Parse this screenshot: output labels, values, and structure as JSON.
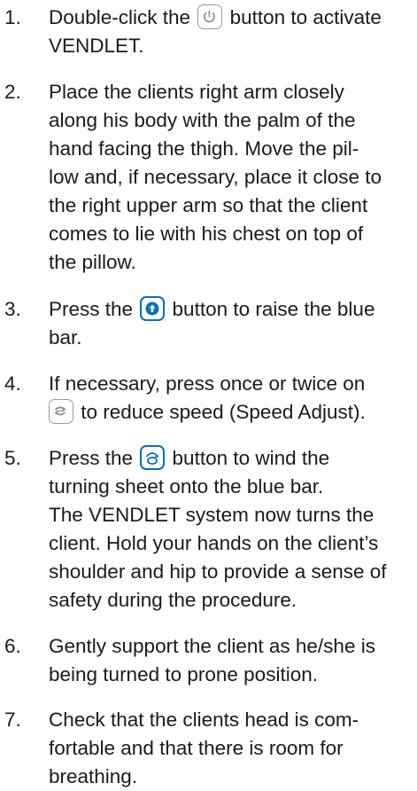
{
  "steps": [
    {
      "number": "1.",
      "lines": [
        [
          "Double-click the ",
          {
            "icon": "power-icon"
          },
          " button to activate"
        ],
        [
          "VENDLET."
        ]
      ]
    },
    {
      "number": "2.",
      "lines": [
        [
          "Place the clients right arm closely"
        ],
        [
          "along his body with the palm of the"
        ],
        [
          "hand facing the thigh. Move the pil-"
        ],
        [
          "low and, if necessary, place it close to"
        ],
        [
          "the right upper arm so that the client"
        ],
        [
          "comes to lie with his chest on top of"
        ],
        [
          "the pillow."
        ]
      ]
    },
    {
      "number": "3.",
      "lines": [
        [
          "Press the ",
          {
            "icon": "arrow-up-icon"
          },
          " button to raise the blue"
        ],
        [
          "bar."
        ]
      ]
    },
    {
      "number": "4.",
      "lines": [
        [
          "If necessary, press once or twice on"
        ],
        [
          {
            "icon": "speed-adjust-icon"
          },
          " to reduce speed (Speed Adjust)."
        ]
      ]
    },
    {
      "number": "5.",
      "lines": [
        [
          "Press the ",
          {
            "icon": "wind-sheet-icon"
          },
          " button to wind the"
        ],
        [
          "turning sheet onto the blue bar."
        ],
        [
          "The VENDLET system now turns the"
        ],
        [
          "client. Hold your hands on the client’s"
        ],
        [
          "shoulder and hip to provide a sense of"
        ],
        [
          "safety during the procedure."
        ]
      ]
    },
    {
      "number": "6.",
      "lines": [
        [
          "Gently support the client as he/she is"
        ],
        [
          "being turned to prone position."
        ]
      ]
    },
    {
      "number": "7.",
      "lines": [
        [
          "Check that the clients head is com-"
        ],
        [
          "fortable and that there is room for"
        ],
        [
          "breathing."
        ]
      ]
    }
  ]
}
